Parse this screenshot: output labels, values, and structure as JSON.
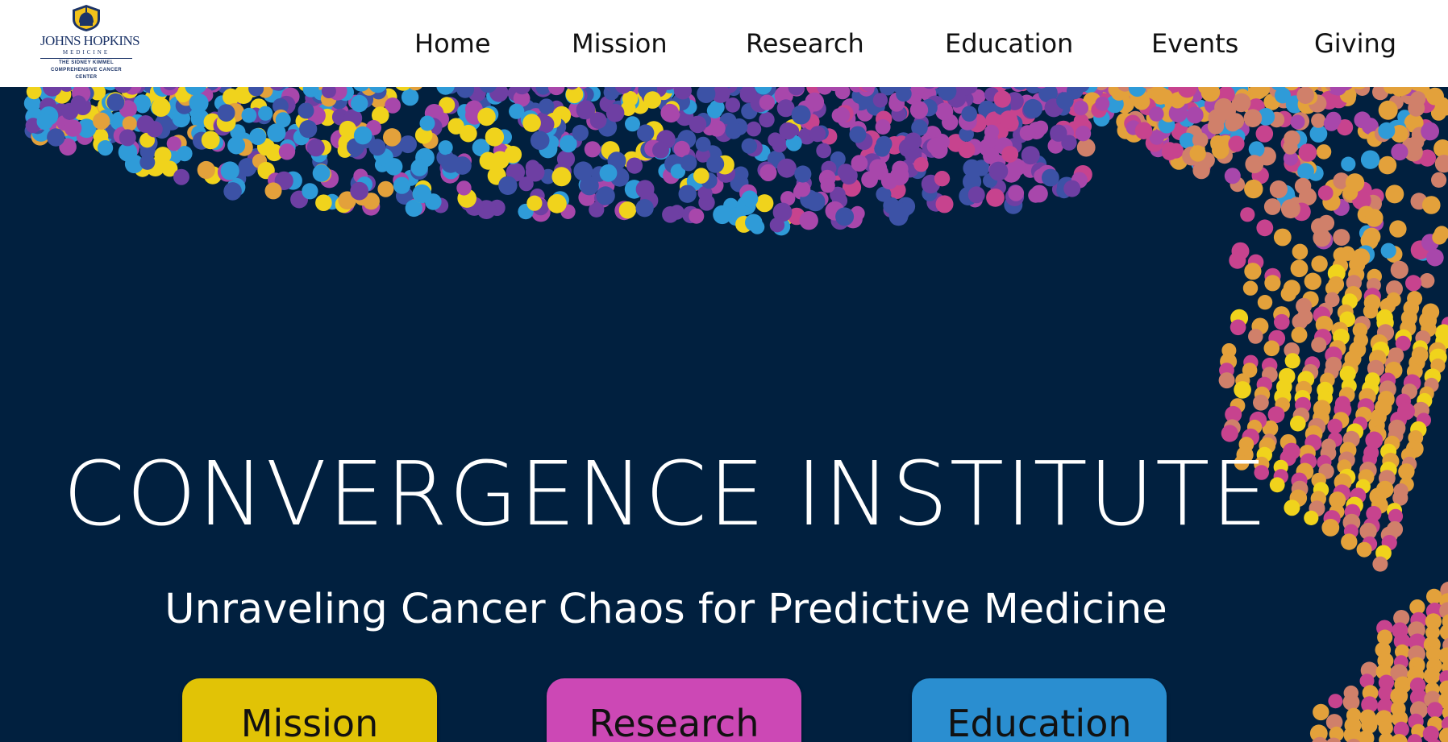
{
  "logo": {
    "name": "JOHNS HOPKINS",
    "sub": "MEDICINE",
    "center_line1": "THE SIDNEY KIMMEL",
    "center_line2": "COMPREHENSIVE CANCER",
    "center_line3": "CENTER"
  },
  "nav": {
    "items": [
      {
        "label": "Home"
      },
      {
        "label": "Mission"
      },
      {
        "label": "Research"
      },
      {
        "label": "Education"
      },
      {
        "label": "Events"
      },
      {
        "label": "Giving"
      }
    ]
  },
  "hero": {
    "title": "CONVERGENCE INSTITUTE",
    "tagline": "Unraveling Cancer Chaos for Predictive Medicine",
    "buttons": [
      {
        "label": "Mission",
        "color": "#e1c306"
      },
      {
        "label": "Research",
        "color": "#cc48b5"
      },
      {
        "label": "Education",
        "color": "#2a8ed0"
      }
    ]
  },
  "colors": {
    "background": "#01203f",
    "dot_palette": [
      "#2f9bd8",
      "#3c52a6",
      "#6e3fa3",
      "#a847ab",
      "#c7438e",
      "#d0806a",
      "#e3a13b",
      "#f0d31c"
    ]
  }
}
